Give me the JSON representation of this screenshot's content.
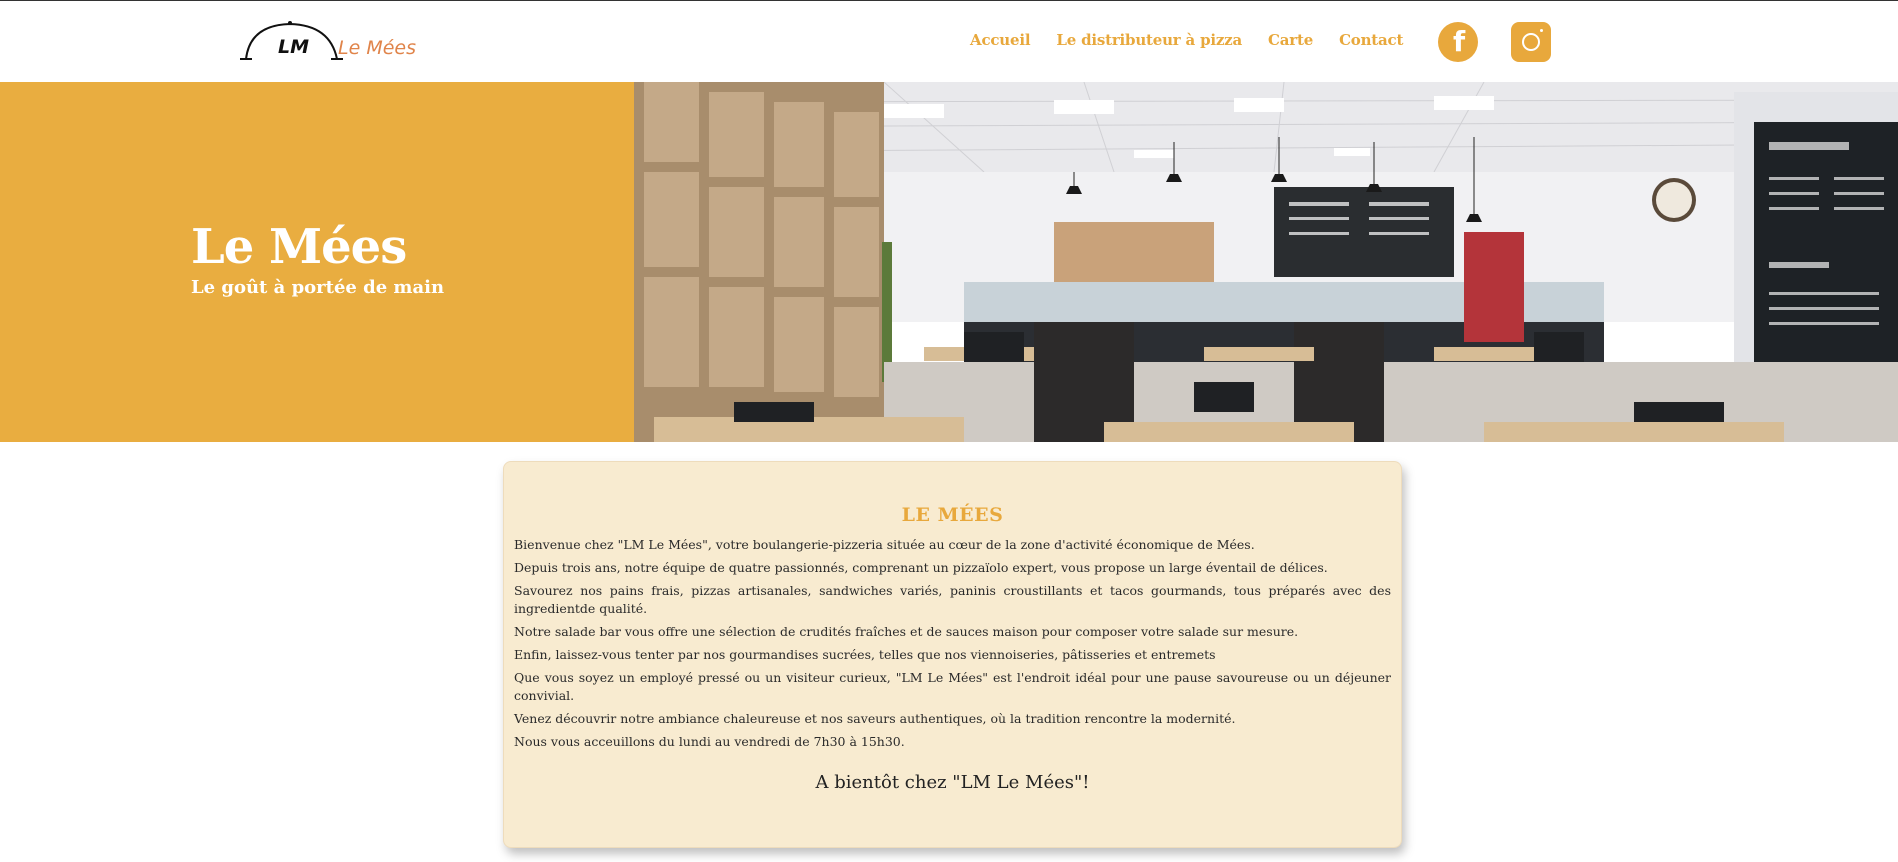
{
  "brand": {
    "logo_mark": "LM",
    "logo_name": "Le Mées"
  },
  "nav": {
    "items": [
      "Accueil",
      "Le distributeur à pizza",
      "Carte",
      "Contact"
    ]
  },
  "social": {
    "facebook_icon": "facebook-icon",
    "instagram_icon": "instagram-icon"
  },
  "hero": {
    "title": "Le Mées",
    "subtitle": "Le goût à portée de main"
  },
  "card": {
    "title": "LE MÉES",
    "paragraphs": [
      "Bienvenue chez \"LM Le Mées\", votre boulangerie-pizzeria située au cœur de la zone d'activité économique de Mées.",
      "Depuis trois ans, notre équipe de quatre passionnés, comprenant un pizzaïolo expert, vous propose un large éventail de délices.",
      "Savourez nos pains frais, pizzas artisanales, sandwiches variés, paninis croustillants et tacos gourmands, tous préparés avec des ingredientde qualité.",
      "Notre salade bar vous offre une sélection de crudités fraîches et de sauces maison pour composer votre salade sur mesure.",
      "Enfin, laissez-vous tenter par nos gourmandises sucrées, telles que nos viennoiseries, pâtisseries et entremets",
      "Que vous soyez un employé pressé ou un visiteur curieux, \"LM Le Mées\" est l'endroit idéal pour une pause savoureuse ou un déjeuner convivial.",
      "Venez découvrir notre ambiance chaleureuse et nos saveurs authentiques, où la tradition rencontre la modernité.",
      "Nous vous acceuillons du lundi au vendredi de 7h30 à 15h30."
    ],
    "closing": "A bientôt chez \"LM Le Mées\"!"
  },
  "colors": {
    "accent": "#e9ad40",
    "card_bg": "#f8ebd0",
    "logo_orange": "#e0844a"
  }
}
